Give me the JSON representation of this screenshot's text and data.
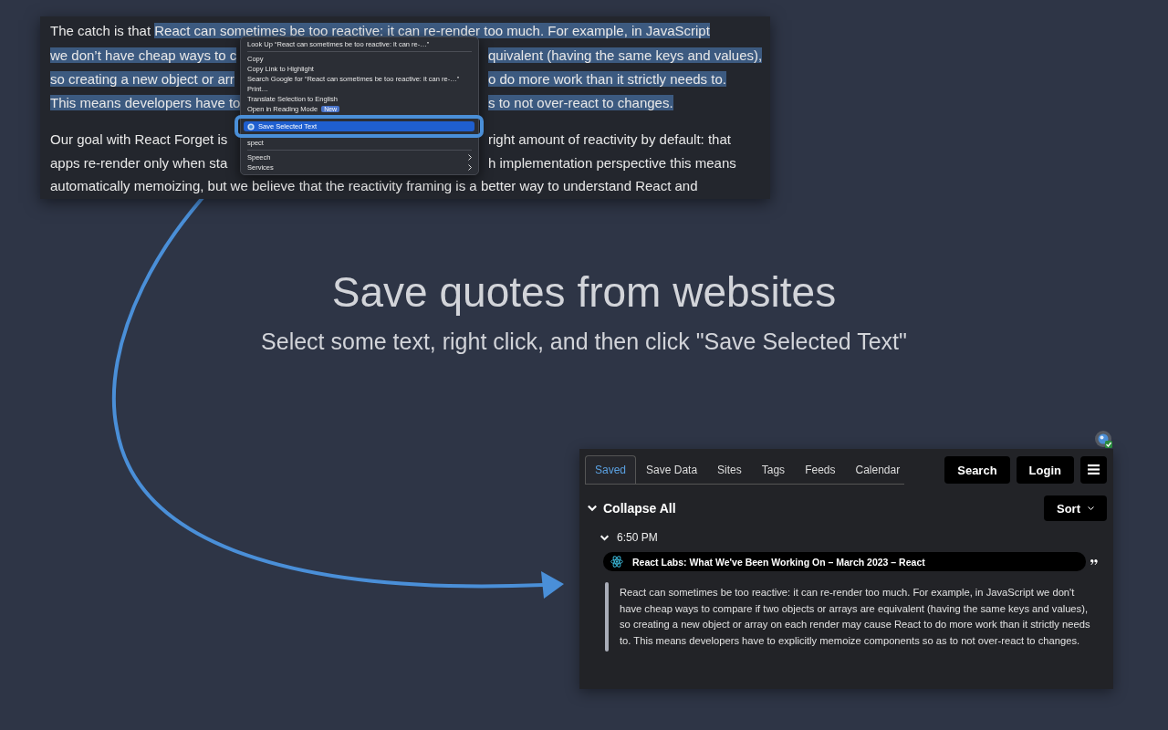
{
  "article": {
    "lines": [
      {
        "left": [
          {
            "text": "The catch is that ",
            "selected": false
          },
          {
            "text": "React can sometimes be too reactive: it can re-render too much. For example, in JavaScript",
            "selected": true
          }
        ]
      },
      {
        "left": [
          {
            "text": "we don’t have cheap ways to c",
            "selected": true
          }
        ],
        "right": [
          {
            "text": "quivalent (having the same keys and values),",
            "selected": true
          }
        ]
      },
      {
        "left": [
          {
            "text": "so creating a new object or arr",
            "selected": true
          }
        ],
        "right": [
          {
            "text": "o do more work than it strictly needs to.",
            "selected": true
          }
        ]
      },
      {
        "left": [
          {
            "text": "This means developers have to",
            "selected": true
          }
        ],
        "right": [
          {
            "text": "s to not over-react to changes.",
            "selected": true
          }
        ],
        "paragraph_end": true
      },
      {
        "left": [
          {
            "text": "Our goal with React Forget is",
            "selected": false
          }
        ],
        "right": [
          {
            "text": "right amount of reactivity by default: that",
            "selected": false
          }
        ]
      },
      {
        "left": [
          {
            "text": "apps re-render only when sta",
            "selected": false
          }
        ],
        "right": [
          {
            "text": "h implementation perspective this means",
            "selected": false
          }
        ]
      },
      {
        "left": [
          {
            "text": "automatically memoizing, but we believe that the reactivity framing is a better way to understand React and",
            "selected": false
          }
        ]
      }
    ]
  },
  "context_menu": {
    "items": [
      {
        "kind": "item",
        "label": "Look Up “React can sometimes be too reactive: it can re-…”",
        "selected": false
      },
      {
        "kind": "separator"
      },
      {
        "kind": "item",
        "label": "Copy",
        "selected": false
      },
      {
        "kind": "item",
        "label": "Copy Link to Highlight",
        "selected": false
      },
      {
        "kind": "item",
        "label": "Search Google for “React can sometimes be too reactive: it can re-…”",
        "selected": false
      },
      {
        "kind": "item",
        "label": "Print…",
        "selected": false
      },
      {
        "kind": "item",
        "label": "Translate Selection to English",
        "selected": false
      },
      {
        "kind": "item",
        "label": "Open in Reading Mode",
        "badge": "New",
        "selected": false
      },
      {
        "kind": "item",
        "label": "Save Selected Text",
        "icon": true,
        "selected": true
      },
      {
        "kind": "item",
        "label": "spect",
        "selected": false
      },
      {
        "kind": "separator"
      },
      {
        "kind": "item",
        "label": "Speech",
        "submenu": true,
        "selected": false
      },
      {
        "kind": "item",
        "label": "Services",
        "submenu": true,
        "selected": false
      }
    ]
  },
  "headline": {
    "title": "Save quotes from websites",
    "subtitle": "Select some text, right click, and then click \"Save Selected Text\""
  },
  "extension": {
    "tabs": [
      {
        "label": "Saved",
        "selected": true
      },
      {
        "label": "Save Data",
        "selected": false
      },
      {
        "label": "Sites",
        "selected": false
      },
      {
        "label": "Tags",
        "selected": false
      },
      {
        "label": "Feeds",
        "selected": false
      },
      {
        "label": "Calendar",
        "selected": false
      }
    ],
    "buttons": [
      "Search",
      "Login"
    ],
    "collapse_all": {
      "label": "Collapse All",
      "expanded": true
    },
    "sort": {
      "label": "Sort"
    },
    "groups": [
      {
        "time": "6:50 PM",
        "expanded": true,
        "quotes": [
          {
            "title": "React Labs: What We've Been Working On – March 2023 – React",
            "text": "React can sometimes be too reactive: it can re-render too much. For example, in JavaScript we don't have cheap ways to compare if two objects or arrays are equivalent (having the same keys and values), so creating a new object or array on each render may cause React to do more work than it strictly needs to. This means developers have to explicitly memoize components so as to not over-react to changes."
          }
        ]
      }
    ]
  }
}
